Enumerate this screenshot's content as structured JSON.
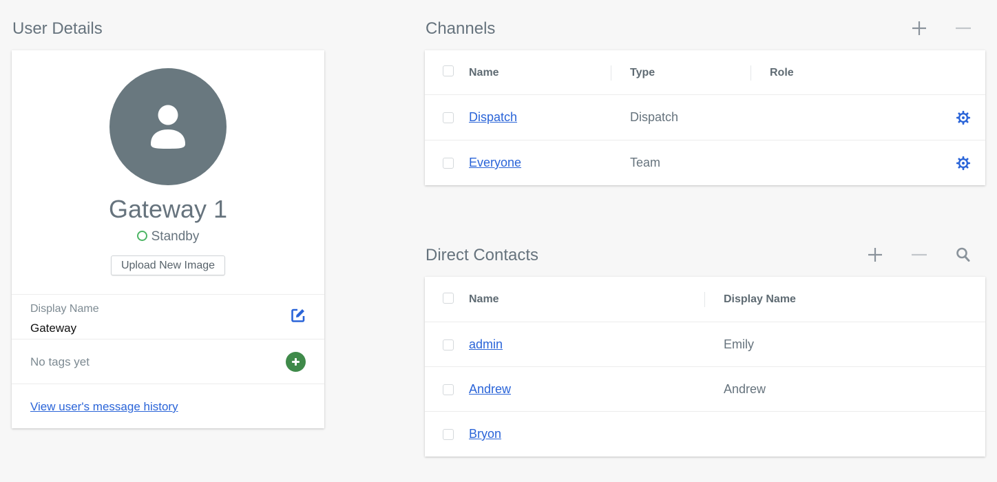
{
  "user_details": {
    "title": "User Details",
    "avatar_icon": "person-icon",
    "name": "Gateway 1",
    "status": "Standby",
    "status_color": "#4cb564",
    "upload_button": "Upload New Image",
    "display_name_label": "Display Name",
    "display_name_value": "Gateway",
    "edit_icon": "edit-icon",
    "tags_empty_text": "No tags yet",
    "add_tag_icon": "plus-circle-icon",
    "history_link": "View user's message history"
  },
  "channels": {
    "title": "Channels",
    "actions": [
      "add-icon",
      "remove-icon"
    ],
    "columns": [
      "Name",
      "Type",
      "Role"
    ],
    "rows": [
      {
        "name": "Dispatch",
        "type": "Dispatch",
        "role": ""
      },
      {
        "name": "Everyone",
        "type": "Team",
        "role": ""
      }
    ]
  },
  "direct_contacts": {
    "title": "Direct Contacts",
    "actions": [
      "add-icon",
      "remove-icon",
      "search-icon"
    ],
    "columns": [
      "Name",
      "Display Name"
    ],
    "rows": [
      {
        "name": "admin",
        "display_name": "Emily"
      },
      {
        "name": "Andrew",
        "display_name": "Andrew"
      },
      {
        "name": "Bryon",
        "display_name": ""
      }
    ]
  },
  "colors": {
    "link": "#2a64d8",
    "accent_green": "#3f8a4a",
    "avatar_bg": "#69787f",
    "text_muted": "#66737d"
  }
}
